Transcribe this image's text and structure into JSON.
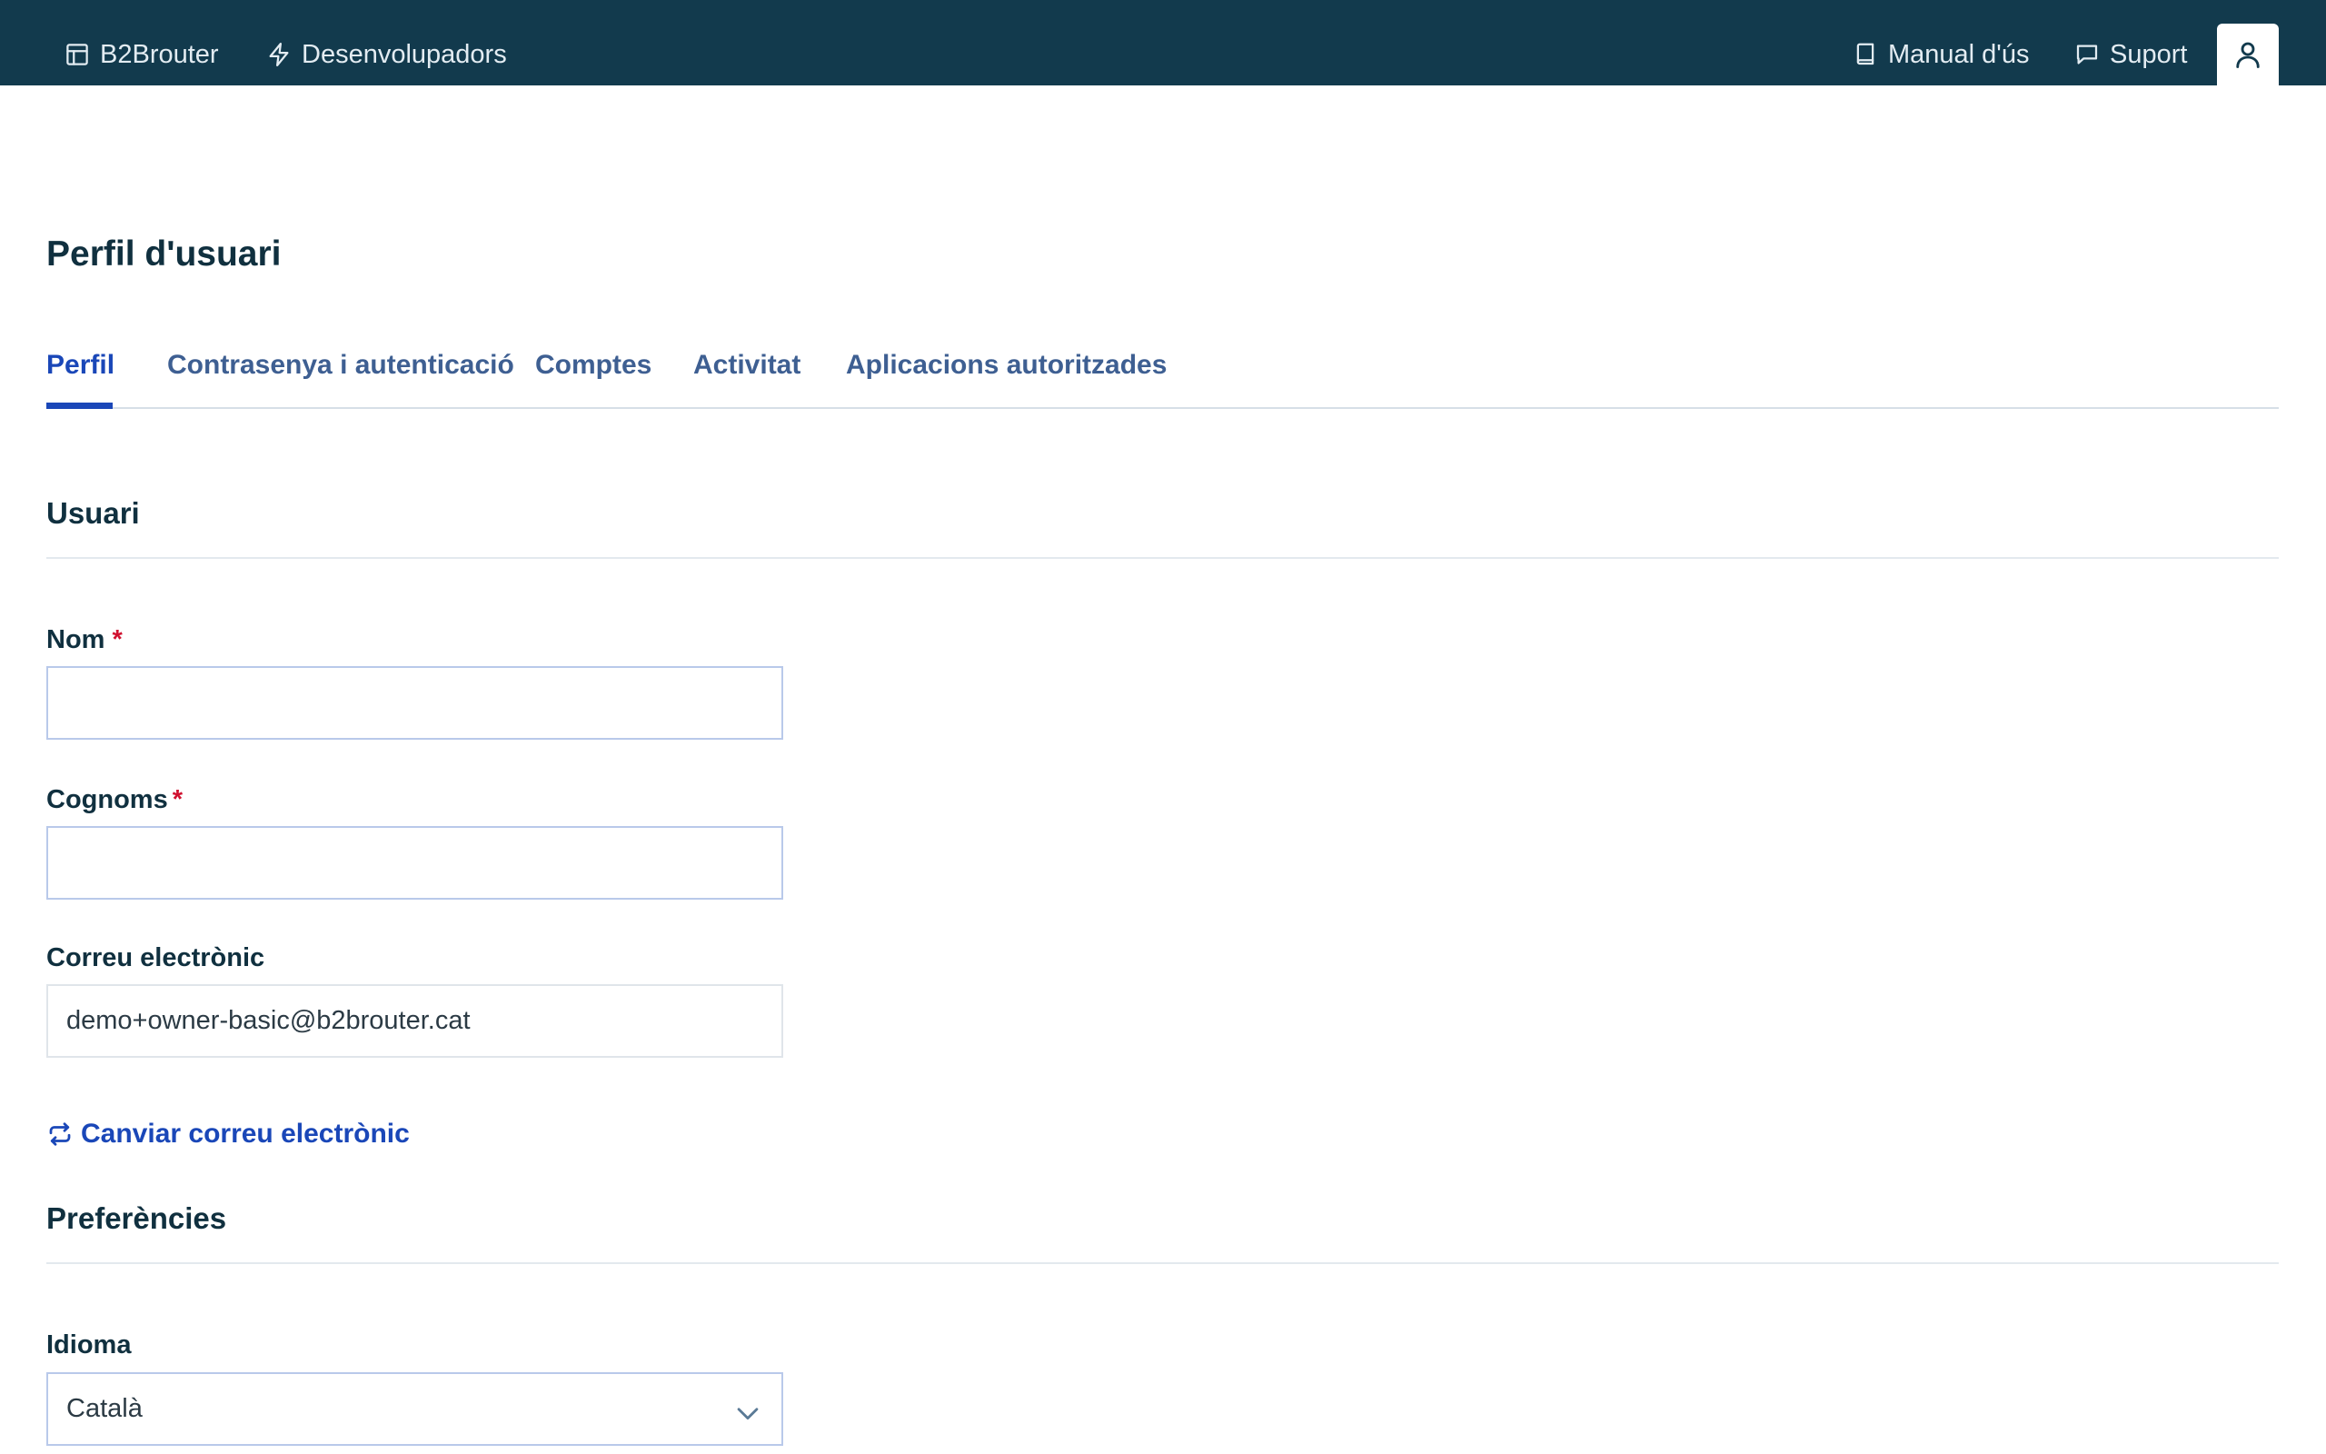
{
  "topbar": {
    "brand_label": "B2Brouter",
    "developers_label": "Desenvolupadors",
    "manual_label": "Manual d'ús",
    "support_label": "Suport"
  },
  "page": {
    "title": "Perfil d'usuari"
  },
  "tabs": [
    {
      "label": "Perfil",
      "active": true
    },
    {
      "label": "Contrasenya i autenticació",
      "active": false
    },
    {
      "label": "Comptes",
      "active": false
    },
    {
      "label": "Activitat",
      "active": false
    },
    {
      "label": "Aplicacions autoritzades",
      "active": false
    }
  ],
  "user_section": {
    "title": "Usuari",
    "name_label": "Nom",
    "name_value": "",
    "surname_label": "Cognoms",
    "surname_value": "",
    "required_mark": "*",
    "email_label": "Correu electrònic",
    "email_value": "demo+owner-basic@b2brouter.cat",
    "change_email_label": "Canviar correu electrònic"
  },
  "preferences_section": {
    "title": "Preferències",
    "language_label": "Idioma",
    "language_value": "Català"
  },
  "colors": {
    "topbar_bg": "#123a4d",
    "accent": "#1a47b8",
    "required": "#d0102f"
  }
}
